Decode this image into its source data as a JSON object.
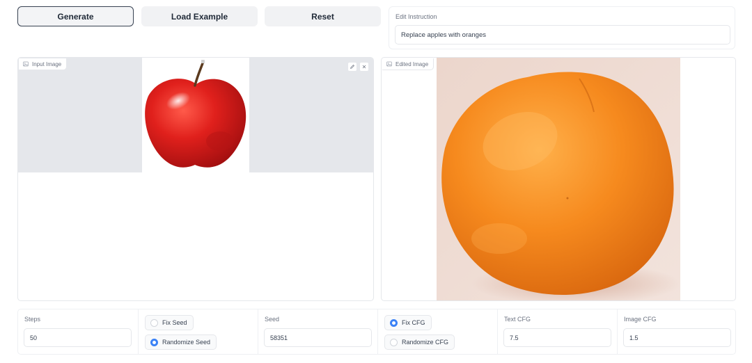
{
  "toolbar": {
    "generate_label": "Generate",
    "load_example_label": "Load Example",
    "reset_label": "Reset"
  },
  "instruction": {
    "label": "Edit Instruction",
    "value": "Replace apples with oranges"
  },
  "input_image": {
    "label": "Input Image",
    "subject": "red apple"
  },
  "edited_image": {
    "label": "Edited Image",
    "subject": "orange"
  },
  "controls": {
    "steps": {
      "label": "Steps",
      "value": "50"
    },
    "seed_mode": {
      "options": [
        "Fix Seed",
        "Randomize Seed"
      ],
      "selected": "Randomize Seed"
    },
    "seed": {
      "label": "Seed",
      "value": "58351"
    },
    "cfg_mode": {
      "options": [
        "Fix CFG",
        "Randomize CFG"
      ],
      "selected": "Fix CFG"
    },
    "text_cfg": {
      "label": "Text CFG",
      "value": "7.5"
    },
    "image_cfg": {
      "label": "Image CFG",
      "value": "1.5"
    }
  },
  "colors": {
    "accent": "#3b82f6",
    "apple": "#d91e1e",
    "orange": "#f28a22",
    "panel_gray": "#e5e7eb"
  },
  "icons": [
    "image-icon",
    "edit-icon",
    "close-icon"
  ]
}
